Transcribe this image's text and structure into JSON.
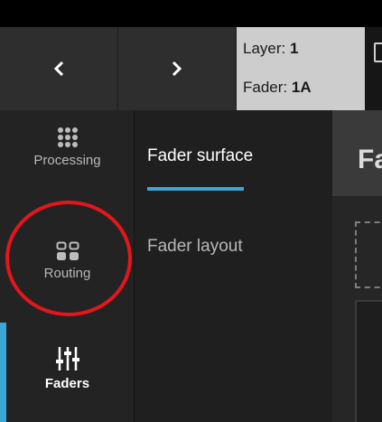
{
  "header": {
    "layer_label": "Layer:",
    "layer_value": "1",
    "fader_label": "Fader:",
    "fader_value": "1A"
  },
  "sidebar": {
    "items": [
      {
        "label": "Processing",
        "icon": "grid-dots-icon"
      },
      {
        "label": "Routing",
        "icon": "routing-icon"
      },
      {
        "label": "Faders",
        "icon": "faders-icon",
        "active": true
      }
    ]
  },
  "subnav": {
    "items": [
      {
        "label": "Fader surface",
        "selected": true
      },
      {
        "label": "Fader layout"
      }
    ]
  },
  "main": {
    "title": "Fa"
  },
  "colors": {
    "accent": "#3aa7d8",
    "highlight": "#e3161c",
    "info_box": "#cdcdcd"
  }
}
